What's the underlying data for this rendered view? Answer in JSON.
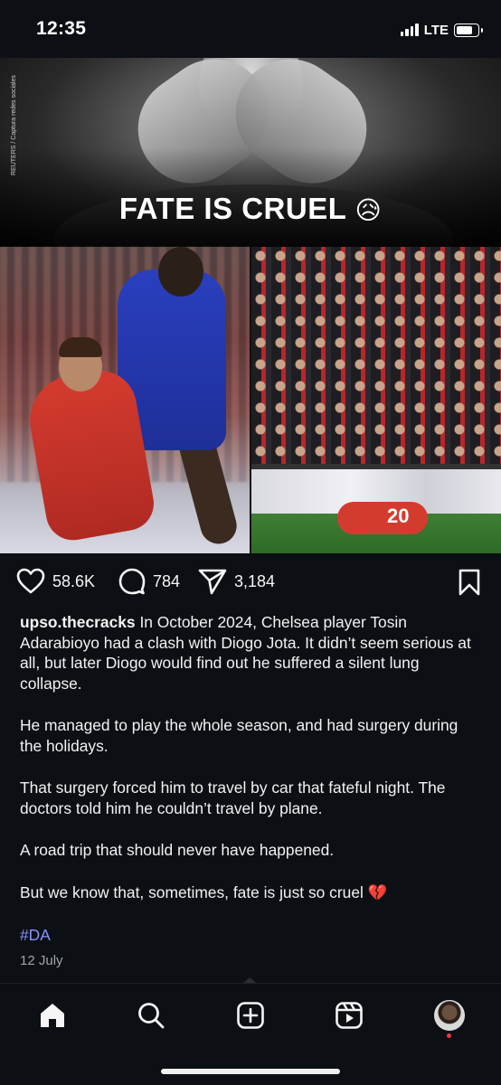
{
  "status_bar": {
    "time": "12:35",
    "network": "LTE",
    "icons": [
      "signal-icon",
      "battery-icon"
    ]
  },
  "post": {
    "image": {
      "headline": "FATE IS CRUEL",
      "headline_emoji": "😥",
      "photo_credit": "REUTERS / Captura redes sociales",
      "jersey_number": "20"
    },
    "actions": {
      "likes": "58.6K",
      "comments": "784",
      "shares": "3,184"
    },
    "caption": {
      "username": "upso.thecracks",
      "paragraphs": [
        "In October 2024, Chelsea player Tosin Adarabioyo had a clash with Diogo Jota. It didn’t seem serious at all, but later Diogo would find out he suffered a silent lung collapse.",
        "He managed to play the whole season, and had surgery during the holidays.",
        "That surgery forced him to travel by car that fateful night. The doctors told him he couldn’t travel by plane.",
        "A road trip that should never have happened.",
        "But we know that, sometimes, fate is just so cruel"
      ],
      "ending_emoji": "💔",
      "hashtag": "#DA"
    },
    "date": "12 July"
  },
  "bottom_nav": {
    "items": [
      "home-icon",
      "search-icon",
      "new-post-icon",
      "reels-icon",
      "profile-avatar"
    ],
    "active": "home-icon"
  },
  "colors": {
    "background": "#0c1014",
    "text": "#f5f5f5",
    "hashtag": "#8a93ff",
    "date": "#a0a4a8",
    "notification_dot": "#ff3040"
  }
}
